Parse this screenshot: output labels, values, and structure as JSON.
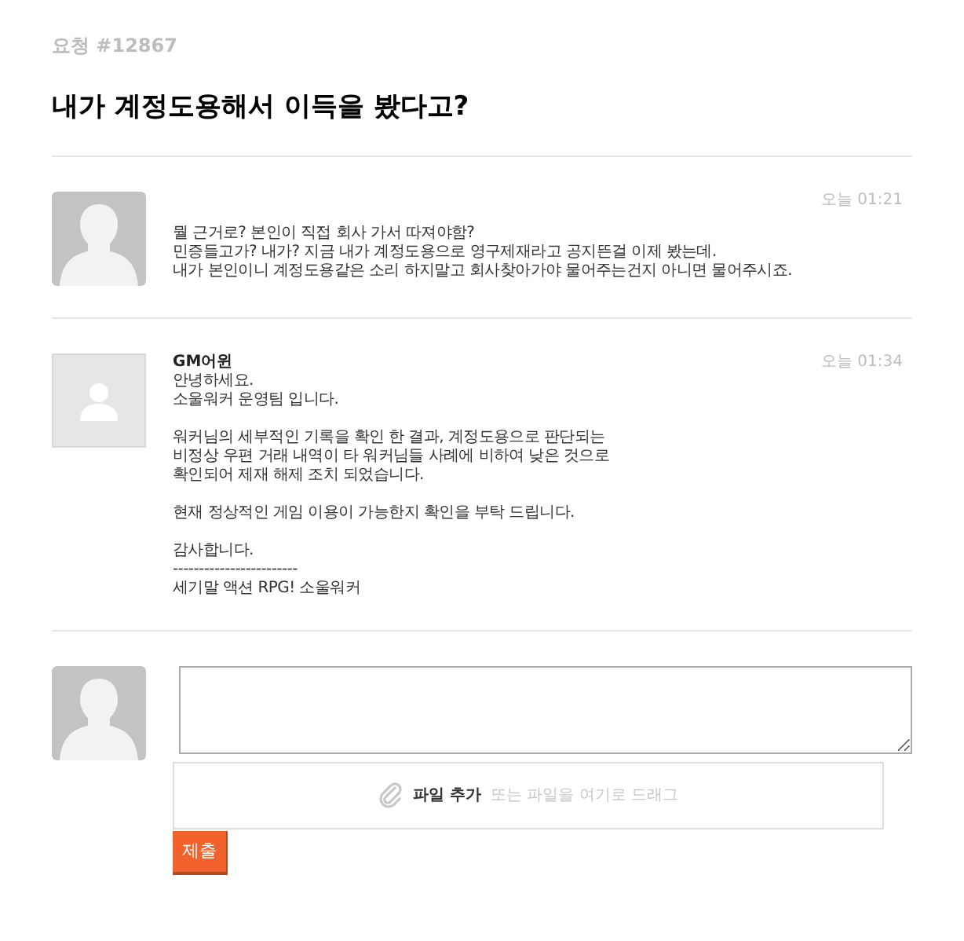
{
  "request_id": "요청 #12867",
  "title": "내가 계정도용해서 이득을 봤다고?",
  "comments": [
    {
      "avatar": {
        "kind": "bust"
      },
      "time": "오늘 01:21",
      "paragraphs": [
        "뭘 근거로? 본인이 직접 회사 가서 따져야함?\n민증들고가? 내가? 지금 내가 계정도용으로 영구제재라고 공지뜬걸 이제 봤는데.\n내가 본인이니 계정도용같은 소리 하지말고 회사찾아가야 물어주는건지 아니면 물어주시죠."
      ]
    },
    {
      "avatar": {
        "kind": "person"
      },
      "author": "GM어윈",
      "time": "오늘 01:34",
      "paragraphs": [
        "안녕하세요.\n소울워커 운영팀 입니다.",
        "워커님의 세부적인 기록을 확인 한 결과, 계정도용으로 판단되는\n비정상 우편 거래 내역이 타 워커님들 사례에 비하여 낮은 것으로\n확인되어 제재 해제 조치 되었습니다.",
        "현재 정상적인 게임 이용이 가능한지 확인을 부탁 드립니다.",
        "감사합니다.\n------------------------\n세기말 액션 RPG! 소울워커"
      ]
    }
  ],
  "reply": {
    "avatar": {
      "kind": "bust"
    },
    "attach_label": "파일 추가",
    "attach_hint": "또는 파일을 여기로 드래그",
    "submit": "제출"
  }
}
